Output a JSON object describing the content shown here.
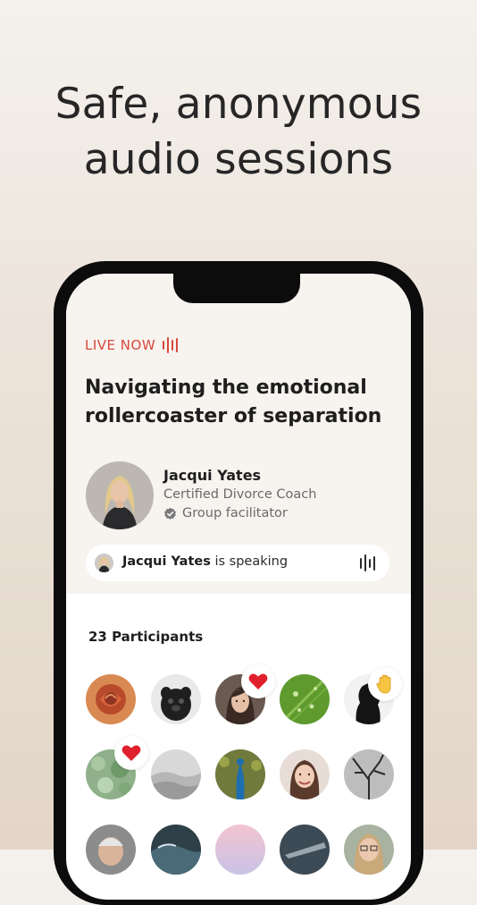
{
  "headline": {
    "line1": "Safe, anonymous",
    "line2": "audio sessions"
  },
  "session": {
    "live_label": "LIVE NOW",
    "title_line1": "Navigating the emotional",
    "title_line2": "rollercoaster of separation",
    "host": {
      "name": "Jacqui Yates",
      "role": "Certified Divorce Coach",
      "badge": "Group facilitator"
    },
    "speaking": {
      "name": "Jacqui Yates",
      "suffix": " is speaking"
    }
  },
  "participants": {
    "label": "23 Participants",
    "avatars": [
      {
        "name": "rose",
        "reaction": ""
      },
      {
        "name": "pug",
        "reaction": ""
      },
      {
        "name": "woman-portrait",
        "reaction": "heart"
      },
      {
        "name": "leaf-drops",
        "reaction": ""
      },
      {
        "name": "silhouette",
        "reaction": "raised-hand"
      },
      {
        "name": "moss",
        "reaction": "heart"
      },
      {
        "name": "misty-hills",
        "reaction": ""
      },
      {
        "name": "peacock",
        "reaction": ""
      },
      {
        "name": "smiling-woman",
        "reaction": ""
      },
      {
        "name": "bare-tree",
        "reaction": ""
      },
      {
        "name": "older-man",
        "reaction": ""
      },
      {
        "name": "surfer-wave",
        "reaction": ""
      },
      {
        "name": "pastel-sky",
        "reaction": ""
      },
      {
        "name": "aircraft",
        "reaction": ""
      },
      {
        "name": "woman-glasses",
        "reaction": ""
      }
    ]
  },
  "colors": {
    "accent": "#d9483b",
    "card": "#f7f3ef",
    "text": "#1e1e1e",
    "heart": "#e0202c"
  }
}
